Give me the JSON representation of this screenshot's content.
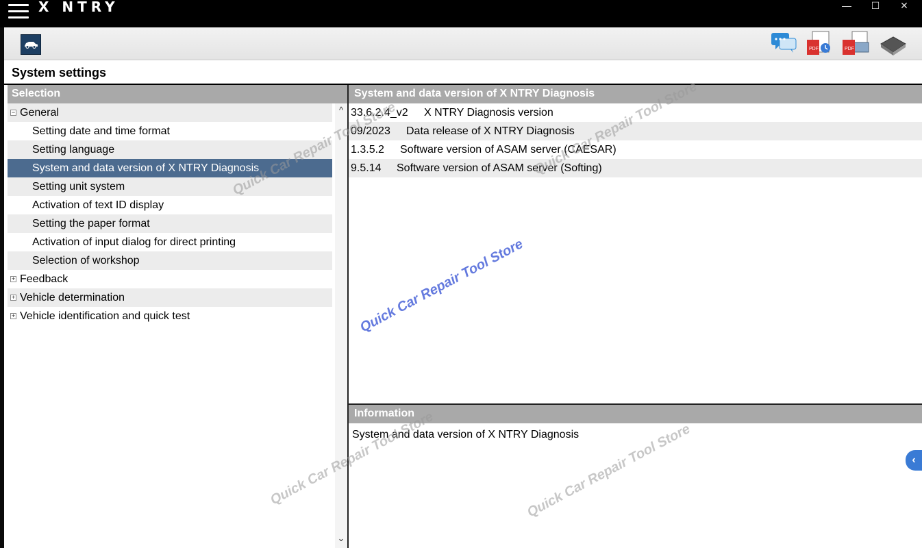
{
  "window": {
    "title": "X  NTRY",
    "minimize": "—",
    "maximize": "☐",
    "close": "✕"
  },
  "toolbar": {
    "icons": [
      "car-icon",
      "chat-icon",
      "pdf-history-icon",
      "pdf-print-icon",
      "book-icon"
    ]
  },
  "page": {
    "title": "System settings"
  },
  "selection": {
    "header": "Selection",
    "items": [
      {
        "label": "General",
        "level": 0,
        "expander": "⊟"
      },
      {
        "label": "Setting date and time format",
        "level": 1
      },
      {
        "label": "Setting language",
        "level": 1
      },
      {
        "label": "System and data version of X  NTRY Diagnosis",
        "level": 1,
        "selected": true
      },
      {
        "label": "Setting unit system",
        "level": 1
      },
      {
        "label": "Activation of text ID display",
        "level": 1
      },
      {
        "label": "Setting the paper format",
        "level": 1
      },
      {
        "label": "Activation of input dialog for direct printing",
        "level": 1
      },
      {
        "label": "Selection of workshop",
        "level": 1
      },
      {
        "label": "Feedback",
        "level": 0,
        "expander": "⊞"
      },
      {
        "label": "Vehicle determination",
        "level": 0,
        "expander": "⊞"
      },
      {
        "label": "Vehicle identification and quick test",
        "level": 0,
        "expander": "⊞"
      }
    ],
    "scroll_up": "^",
    "scroll_down": "⌄"
  },
  "details": {
    "header": "System and data version of X  NTRY Diagnosis",
    "rows": [
      {
        "version": "33.6.2.4_v2",
        "description": "X  NTRY Diagnosis version"
      },
      {
        "version": "09/2023",
        "description": "Data release of X  NTRY Diagnosis"
      },
      {
        "version": "1.3.5.2",
        "description": "Software version of ASAM server (CAESAR)"
      },
      {
        "version": "9.5.14",
        "description": "Software version of ASAM server (Softing)"
      }
    ]
  },
  "information": {
    "header": "Information",
    "text": "System and data version of X  NTRY Diagnosis"
  },
  "side_tab": {
    "label": "‹"
  },
  "watermark": "Quick Car Repair Tool Store",
  "colors": {
    "header_grey": "#a9a9a9",
    "selected_row": "#4c6b8f",
    "watermark": "#4a63d9",
    "side_tab": "#3a7bd5"
  }
}
